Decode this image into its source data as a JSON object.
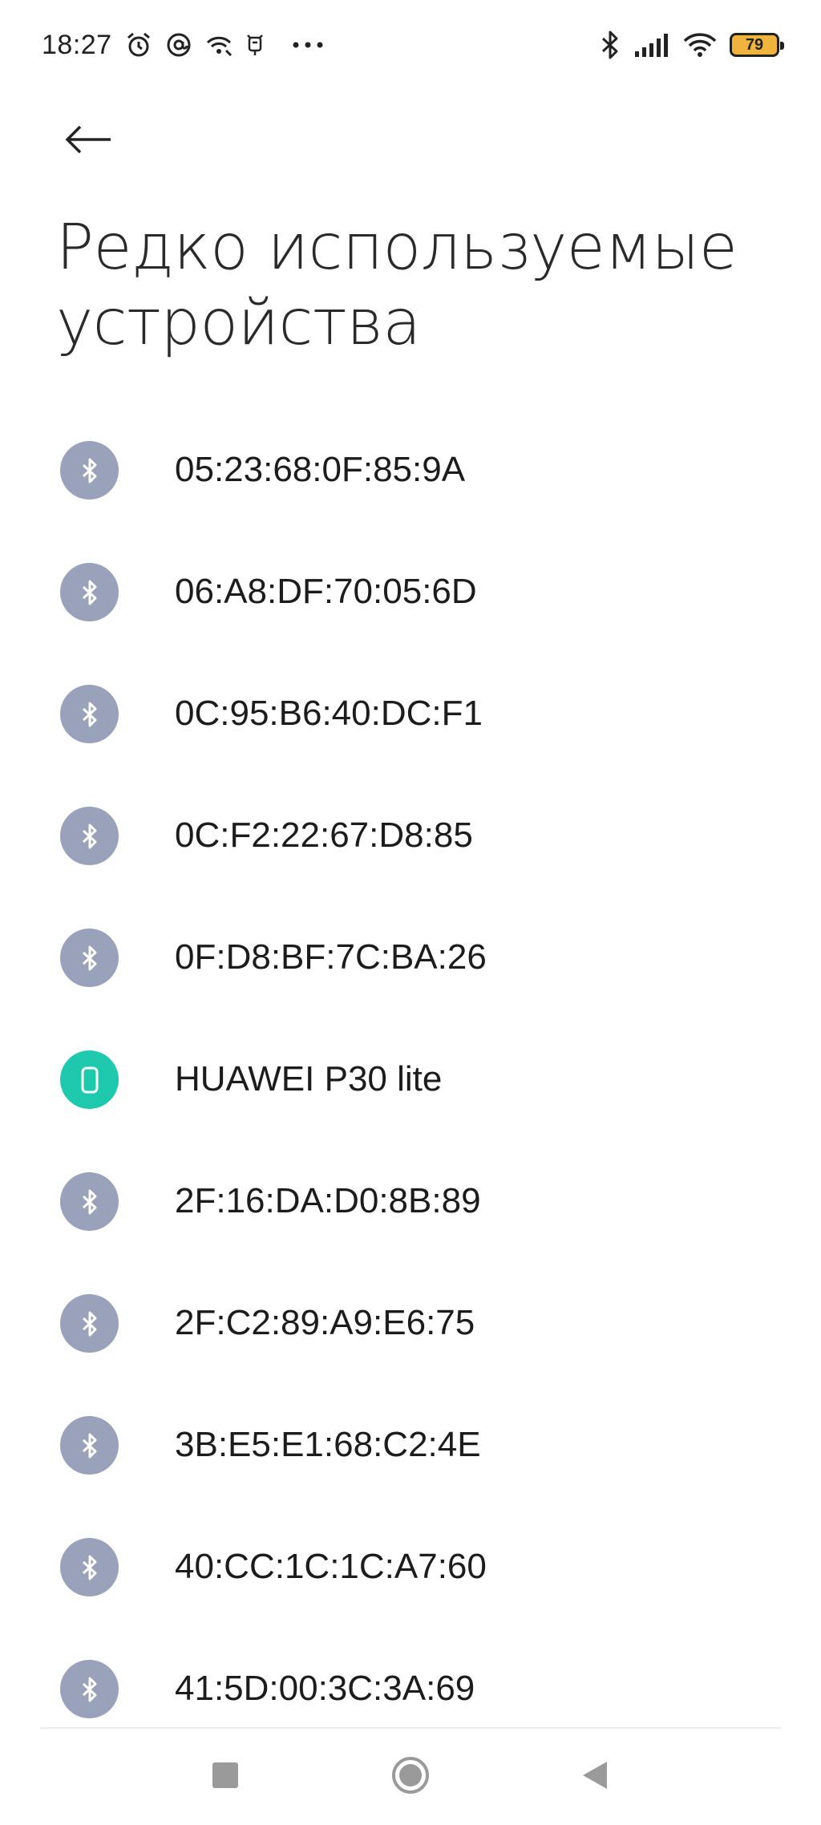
{
  "status_bar": {
    "time": "18:27",
    "battery_level": "79",
    "icons_left": [
      "alarm-icon",
      "at-sign-icon",
      "hotspot-icon",
      "glasses-icon",
      "more-dots-icon"
    ],
    "icons_right": [
      "bluetooth-icon",
      "signal-icon",
      "wifi-icon",
      "battery-icon"
    ]
  },
  "header": {
    "back_icon": "arrow-left-icon",
    "title_line1": "Редко используемые",
    "title_line2": "устройства"
  },
  "devices": [
    {
      "name": "05:23:68:0F:85:9A",
      "icon": "bluetooth-icon"
    },
    {
      "name": "06:A8:DF:70:05:6D",
      "icon": "bluetooth-icon"
    },
    {
      "name": "0C:95:B6:40:DC:F1",
      "icon": "bluetooth-icon"
    },
    {
      "name": "0C:F2:22:67:D8:85",
      "icon": "bluetooth-icon"
    },
    {
      "name": "0F:D8:BF:7C:BA:26",
      "icon": "bluetooth-icon"
    },
    {
      "name": "HUAWEI P30 lite",
      "icon": "phone-icon"
    },
    {
      "name": "2F:16:DA:D0:8B:89",
      "icon": "bluetooth-icon"
    },
    {
      "name": "2F:C2:89:A9:E6:75",
      "icon": "bluetooth-icon"
    },
    {
      "name": "3B:E5:E1:68:C2:4E",
      "icon": "bluetooth-icon"
    },
    {
      "name": "40:CC:1C:1C:A7:60",
      "icon": "bluetooth-icon"
    },
    {
      "name": "41:5D:00:3C:3A:69",
      "icon": "bluetooth-icon"
    }
  ],
  "colors": {
    "bluetooth_avatar": "#9aa1bb",
    "phone_avatar": "#1ec9ad",
    "battery_fill": "#f0b43c"
  },
  "nav": {
    "recents_icon": "square-icon",
    "home_icon": "circle-icon",
    "back_icon": "triangle-back-icon"
  }
}
